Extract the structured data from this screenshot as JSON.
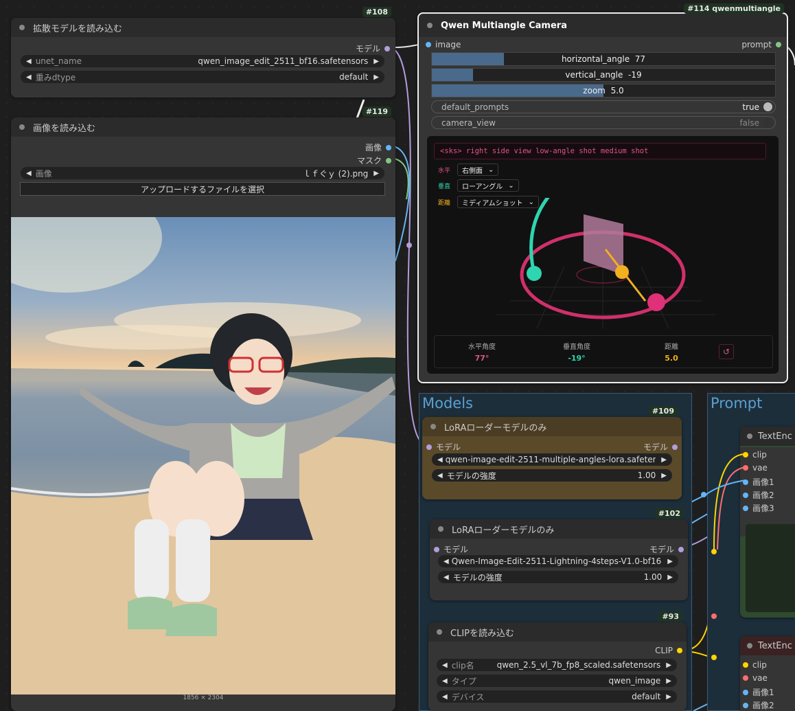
{
  "nodes": {
    "n108": {
      "badge": "#108",
      "title": "拡散モデルを読み込む",
      "output_label": "モデル",
      "widgets": [
        {
          "label": "unet_name",
          "value": "qwen_image_edit_2511_bf16.safetensors"
        },
        {
          "label": "重みdtype",
          "value": "default"
        }
      ]
    },
    "n119": {
      "badge": "#119",
      "title": "画像を読み込む",
      "output_image": "画像",
      "output_mask": "マスク",
      "image_label": "画像",
      "image_value": "ｌｆぐｙ (2).png",
      "upload_button": "アップロードするファイルを選択",
      "image_size": "1856 × 2304"
    },
    "n114": {
      "badge": "#114 qwenmultiangle",
      "title": "Qwen Multiangle Camera",
      "input_label": "image",
      "output_label": "prompt",
      "sliders": [
        {
          "label": "horizontal_angle",
          "value": "77",
          "fraction": 0.21
        },
        {
          "label": "vertical_angle",
          "value": "-19",
          "fraction": 0.12
        },
        {
          "label": "zoom",
          "value": "5.0",
          "fraction": 0.5
        }
      ],
      "toggles": [
        {
          "label": "default_prompts",
          "value": "true"
        },
        {
          "label": "camera_view",
          "value": "false"
        }
      ],
      "camera": {
        "prompt_text": "<sks> right side view low-angle shot medium shot",
        "rows": [
          {
            "tag": "水平",
            "value": "右側面",
            "color": "#e0558a"
          },
          {
            "tag": "垂直",
            "value": "ローアングル",
            "color": "#2fd4b0"
          },
          {
            "tag": "距離",
            "value": "ミディアムショット",
            "color": "#f0b020"
          }
        ],
        "stats": [
          {
            "label": "水平角度",
            "value": "77°",
            "color": "#e0558a"
          },
          {
            "label": "垂直角度",
            "value": "-19°",
            "color": "#2fd4b0"
          },
          {
            "label": "距離",
            "value": "5.0",
            "color": "#f0b020"
          }
        ],
        "reset_icon": "↺"
      }
    },
    "n109": {
      "badge": "#109",
      "title": "LoRAローダーモデルのみ",
      "input_label": "モデル",
      "output_label": "モデル",
      "widgets": [
        {
          "label": "",
          "value": "qwen-image-edit-2511-multiple-angles-lora.safetens ..."
        },
        {
          "label": "モデルの強度",
          "value": "1.00"
        }
      ]
    },
    "n102": {
      "badge": "#102",
      "title": "LoRAローダーモデルのみ",
      "input_label": "モデル",
      "output_label": "モデル",
      "widgets": [
        {
          "label": "",
          "value": "Qwen-Image-Edit-2511-Lightning-4steps-V1.0-bf16.s ..."
        },
        {
          "label": "モデルの強度",
          "value": "1.00"
        }
      ]
    },
    "n93": {
      "badge": "#93",
      "title": "CLIPを読み込む",
      "output_label": "CLIP",
      "widgets": [
        {
          "label": "clip名",
          "value": "qwen_2.5_vl_7b_fp8_scaled.safetensors"
        },
        {
          "label": "タイプ",
          "value": "qwen_image"
        },
        {
          "label": "デバイス",
          "value": "default"
        }
      ]
    },
    "te1": {
      "title": "TextEnc",
      "inputs": [
        "clip",
        "vae",
        "画像1",
        "画像2",
        "画像3"
      ]
    },
    "te2": {
      "title": "TextEnc",
      "inputs": [
        "clip",
        "vae",
        "画像1",
        "画像2"
      ]
    }
  },
  "groups": {
    "models": "Models",
    "prompt": "Prompt"
  },
  "colors": {
    "model_slot": "#b39ddb",
    "image_slot": "#64b5f6",
    "mask_slot": "#81c784",
    "clip_slot": "#ffd500",
    "vae_slot": "#ff6e6e",
    "lora_node": "#5a4a2a",
    "text_node": "#2f4a2f"
  }
}
